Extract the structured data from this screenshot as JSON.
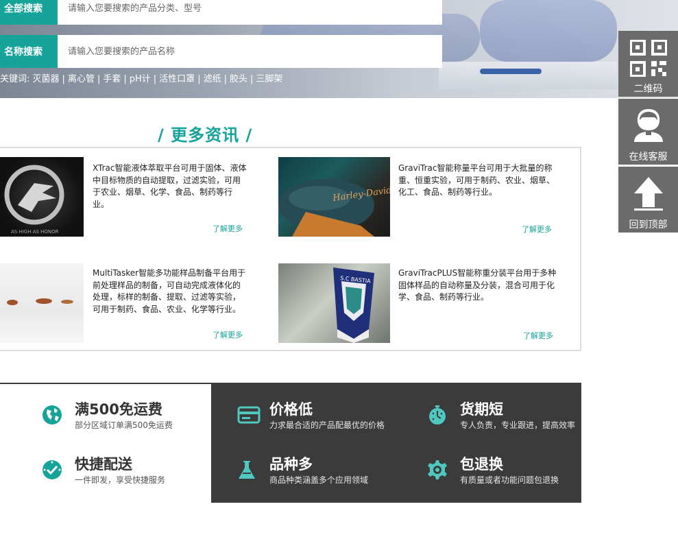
{
  "search": {
    "category_label": "全部搜索",
    "category_placeholder": "请输入您要搜索的产品分类、型号",
    "name_label": "名称搜索",
    "name_placeholder": "请输入您要搜索的产品名称",
    "keywords_prefix": "关键词:",
    "keywords": [
      "灭菌器",
      "离心管",
      "手套",
      "pH计",
      "活性口罩",
      "滤纸",
      "胶头",
      "三脚架"
    ],
    "separator": "|"
  },
  "side_bar": {
    "qr_label": "二维码",
    "service_label": "在线客服",
    "top_label": "回到顶部"
  },
  "more_news": {
    "title": "更多资讯",
    "read_more": "了解更多",
    "items": [
      {
        "desc": "XTrac智能液体萃取平台可用于固体、液体中目标物质的自动提取，过滤实验，可用于农业、烟草、化学、食品、制药等行业。",
        "image_text": "AS HIGH AS HONOR"
      },
      {
        "desc": "GraviTrac智能称量平台可用于大批量的称重、恒重实验，可用于制药、农业、烟草、化工、食品、制药等行业。",
        "image_text": "Harley-Davidson"
      },
      {
        "desc": "MultiTasker智能多功能样品制备平台用于前处理样品的制备，可自动完成液体化的处理，标样的制备、提取、过滤等实验，可用于制药、食品、农业、化学等行业。",
        "image_text": ""
      },
      {
        "desc": "GraviTracPLUS智能称重分装平台用于多种固体样品的自动称量及分装，混合可用于化学、食品、制药等行业。",
        "image_text": "S.C BASTIA"
      }
    ]
  },
  "features": {
    "free_shipping": {
      "title": "满500免运费",
      "sub": "部分区域订单满500免运费"
    },
    "fast_delivery": {
      "title": "快捷配送",
      "sub": "一件即发，享受快捷服务"
    },
    "low_price": {
      "title": "价格低",
      "sub": "力求最合适的产品配最优的价格"
    },
    "variety": {
      "title": "品种多",
      "sub": "商品种类涵盖多个应用领域"
    },
    "short_period": {
      "title": "货期短",
      "sub": "专人负责，专业跟进，提高效率"
    },
    "returns": {
      "title": "包退换",
      "sub": "有质量或者功能问题包退换"
    }
  },
  "colors": {
    "accent": "#16a39a",
    "dark_panel": "#3b3b3b",
    "side_btn": "#6b6b6b"
  }
}
